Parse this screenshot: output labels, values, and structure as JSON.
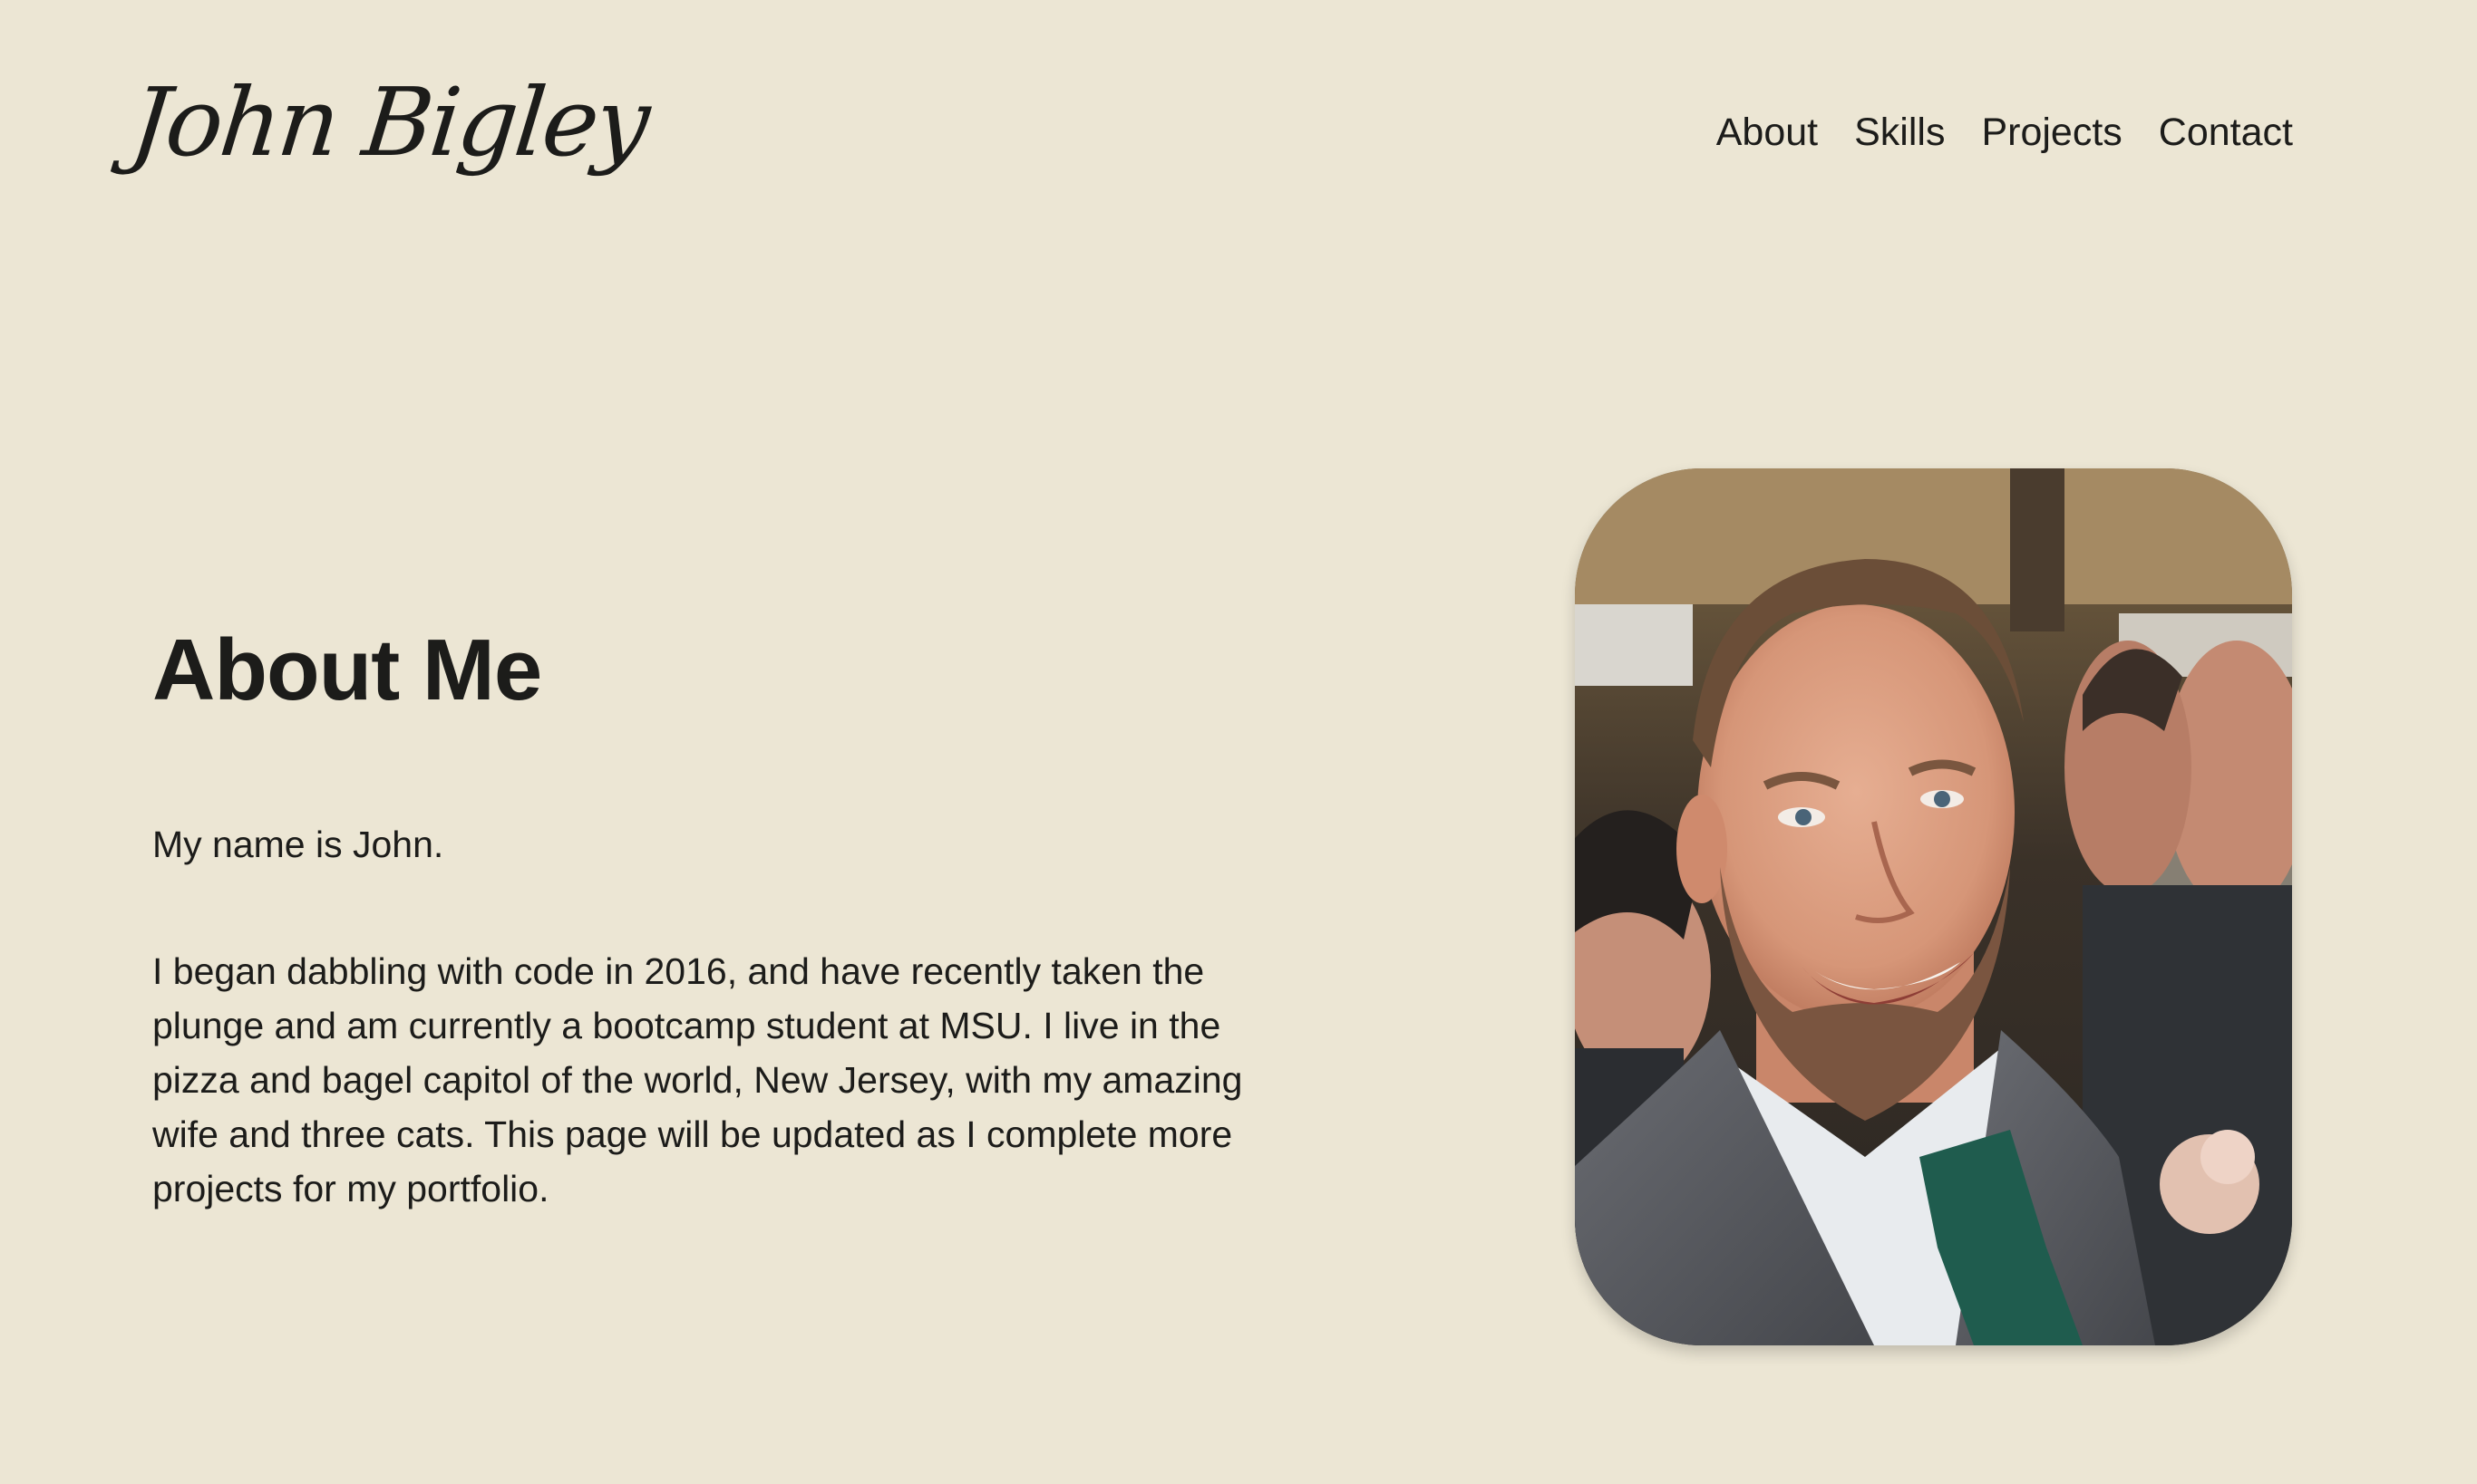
{
  "header": {
    "logo_text": "John Bigley",
    "nav": [
      {
        "label": "About"
      },
      {
        "label": "Skills"
      },
      {
        "label": "Projects"
      },
      {
        "label": "Contact"
      }
    ]
  },
  "about": {
    "title": "About Me",
    "intro": "My name is John.",
    "bio": "I began dabbling with code in 2016, and have recently taken the plunge and am currently a bootcamp student at MSU. I live in the pizza and bagel capitol of the world, New Jersey, with my amazing wife and three cats. This page will be updated as I complete more projects for my portfolio."
  },
  "colors": {
    "background": "#ece6d4",
    "text": "#1c1c1a",
    "tie": "#1f5c4e",
    "suit": "#55575c"
  },
  "icons": {
    "profile_photo": "portrait-photo-icon"
  }
}
